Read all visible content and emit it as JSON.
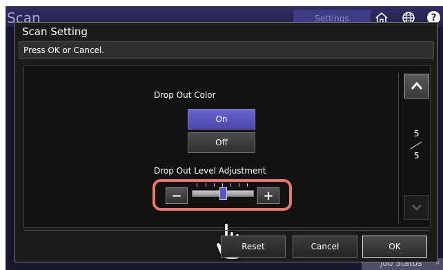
{
  "app": {
    "title": "Scan",
    "settings_tab": "Settings",
    "job_status": "Job Status",
    "job_status_close": "×",
    "help": "?"
  },
  "dialog": {
    "title": "Scan Setting",
    "message": "Press OK or Cancel.",
    "drop_out_color": {
      "label": "Drop Out Color",
      "options": [
        "On",
        "Off"
      ],
      "selected": "On"
    },
    "drop_out_level": {
      "label": "Drop Out Level Adjustment",
      "level_fraction": 0.5,
      "minus": "−",
      "plus": "+"
    },
    "pagination": {
      "current": "5",
      "total": "5"
    },
    "buttons": {
      "reset": "Reset",
      "cancel": "Cancel",
      "ok": "OK"
    }
  },
  "colors": {
    "accent": "#4c47aa",
    "highlight": "#e8796a",
    "topbar": "#24224b"
  },
  "icons": [
    "home-icon",
    "globe-icon",
    "help-icon",
    "chevron-up-icon",
    "chevron-down-icon",
    "pointing-hand-icon"
  ]
}
